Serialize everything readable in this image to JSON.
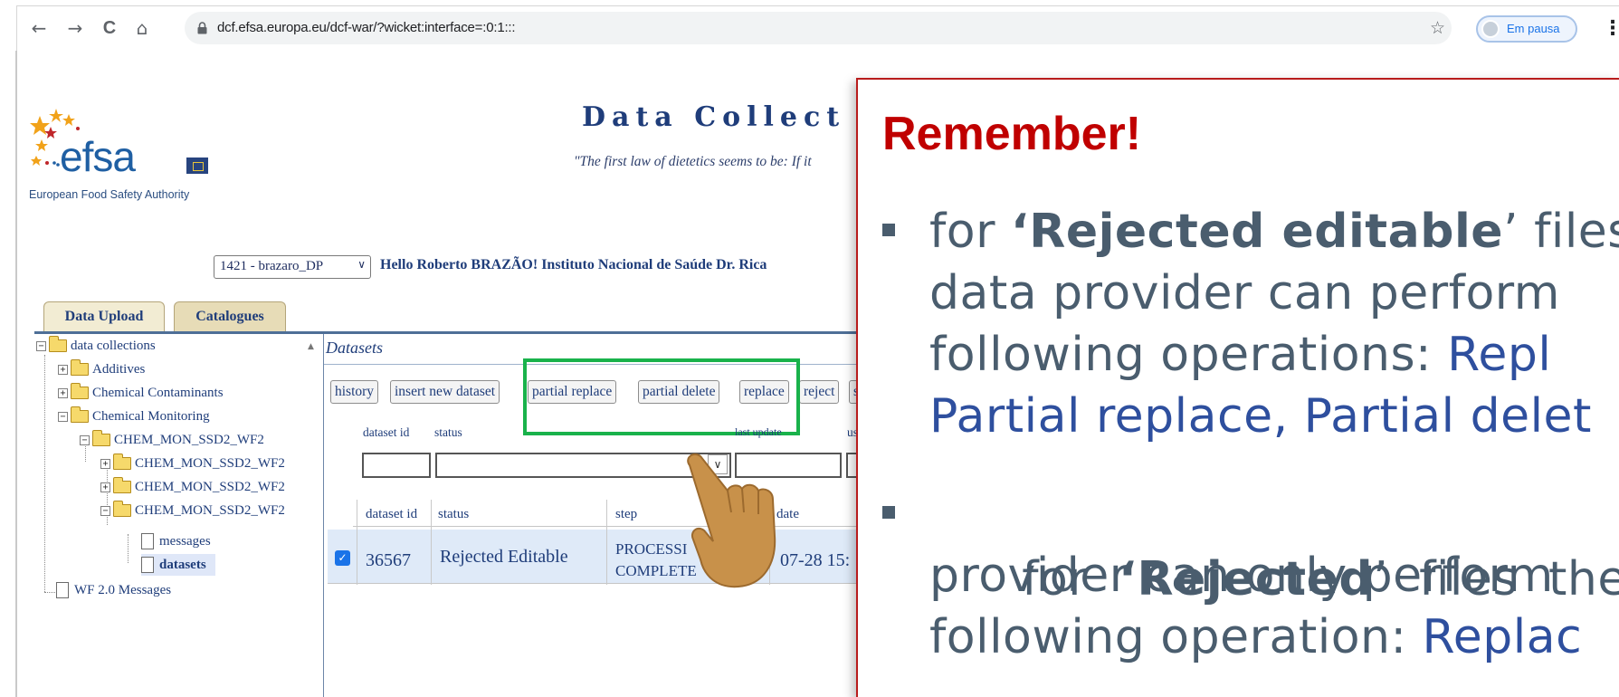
{
  "browser": {
    "nav": {
      "back": "←",
      "forward": "→",
      "reload": "C",
      "home": "⌂"
    },
    "url": "dcf.efsa.europa.eu/dcf-war/?wicket:interface=:0:1:::",
    "profile_label": "Em pausa",
    "star": "☆",
    "kebab": "⋮"
  },
  "page": {
    "logo_word": "efsa",
    "logo_tagline": "European Food Safety Authority",
    "heading": "Data Collect",
    "quote": "\"The first law of dietetics seems to be: If it",
    "user_select": "1421 - brazaro_DP",
    "greeting": "Hello Roberto BRAZÃO! Instituto Nacional de Saúde Dr. Rica",
    "tabs": [
      "Data Upload",
      "Catalogues"
    ],
    "tree": [
      {
        "toggle": "−",
        "label": "data collections"
      },
      {
        "toggle": "+",
        "label": "Additives"
      },
      {
        "toggle": "+",
        "label": "Chemical Contaminants"
      },
      {
        "toggle": "−",
        "label": "Chemical Monitoring"
      },
      {
        "toggle": "−",
        "label": "CHEM_MON_SSD2_WF2"
      },
      {
        "toggle": "+",
        "label": "CHEM_MON_SSD2_WF2"
      },
      {
        "toggle": "+",
        "label": "CHEM_MON_SSD2_WF2"
      },
      {
        "toggle": "−",
        "label": "CHEM_MON_SSD2_WF2"
      },
      {
        "label": "messages"
      },
      {
        "label": "datasets"
      },
      {
        "label": "WF 2.0 Messages"
      }
    ],
    "datasets_title": "Datasets",
    "actions": [
      "history",
      "insert new dataset",
      "partial replace",
      "partial delete",
      "replace",
      "reject",
      "su"
    ],
    "filters": {
      "dataset_id": "dataset id",
      "status": "status",
      "last_update": "last update",
      "user": "us"
    },
    "grid_headers": {
      "dataset_id": "dataset id",
      "status": "status",
      "step": "step",
      "date": "date"
    },
    "row": {
      "checked": "✓",
      "dataset_id": "36567",
      "status": "Rejected Editable",
      "step_line1": "PROCESSI",
      "step_line2": "COMPLETE",
      "date": "07-28 15:"
    }
  },
  "callout": {
    "title": "Remember!",
    "bullet1": {
      "l1_pre": "for ",
      "l1_bold": "‘Rejected editable",
      "l1_post": "’ files",
      "l2": "data provider can perform",
      "l3_pre": "following operations: ",
      "l3_blue": "Repl",
      "l4": "Partial replace, Partial delet"
    },
    "bullet2": {
      "l1_pre": "for  ",
      "l1_bold": "‘Rejected",
      "l1_post": "’  files  the  d",
      "l2": "provider can only perform",
      "l3_pre": "following operation: ",
      "l3_blue": "Replac"
    }
  },
  "colors": {
    "callout_title": "#c00000",
    "callout_border": "#b81c1c",
    "highlight_box": "#19b24b",
    "link_blue": "#2e4f9e",
    "body_gray": "#4a5d6e"
  },
  "icons": [
    "back-arrow-icon",
    "forward-arrow-icon",
    "reload-icon",
    "home-icon",
    "lock-icon",
    "star-icon",
    "kebab-menu-icon",
    "folder-icon",
    "file-icon",
    "pointing-hand-icon",
    "checkbox-icon"
  ]
}
